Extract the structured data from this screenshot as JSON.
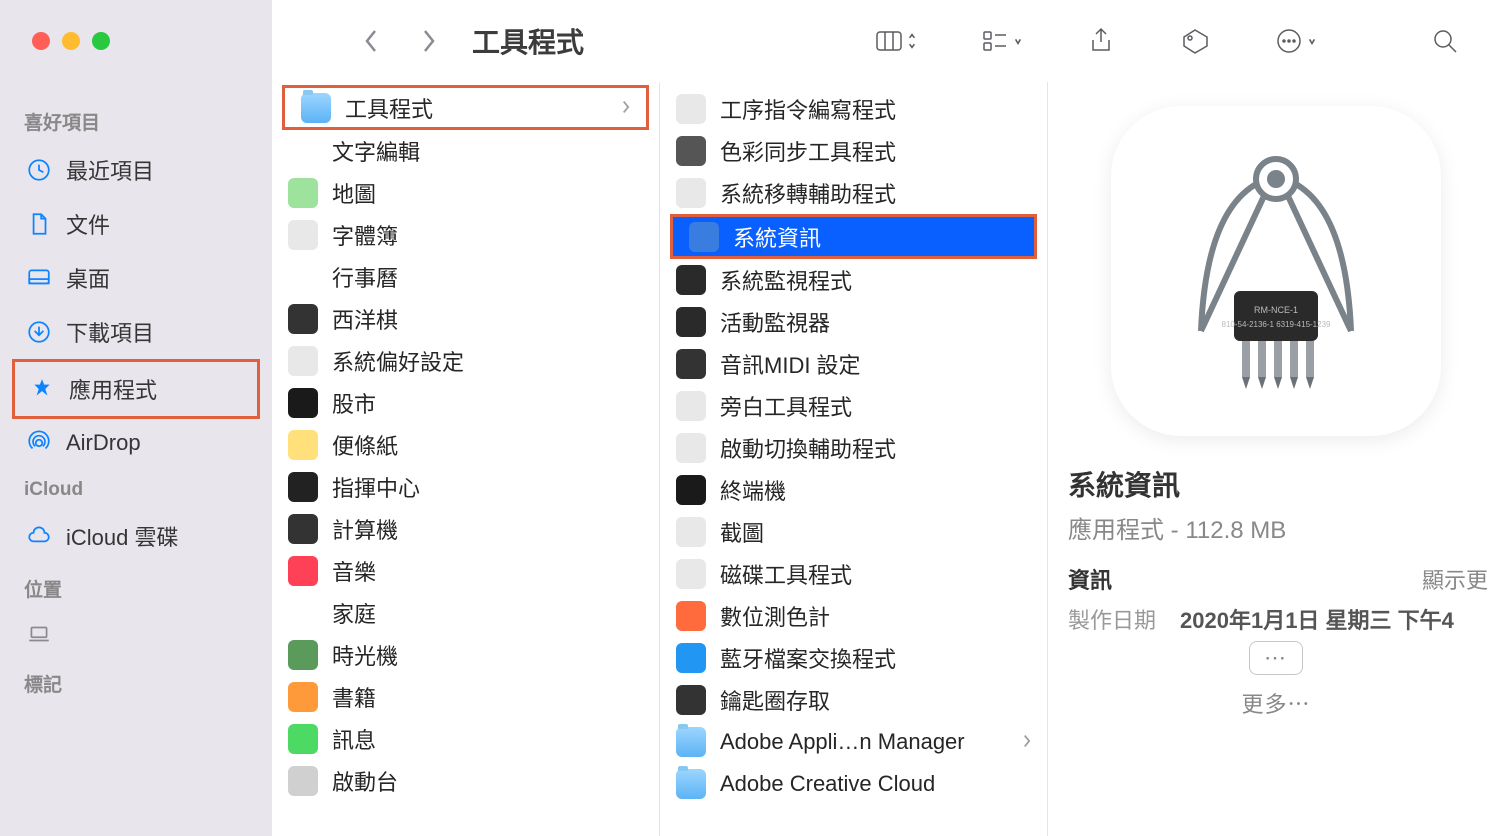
{
  "toolbar": {
    "title": "工具程式"
  },
  "sidebar": {
    "sections": [
      {
        "header": "喜好項目",
        "items": [
          {
            "label": "最近項目",
            "icon": "clock"
          },
          {
            "label": "文件",
            "icon": "doc"
          },
          {
            "label": "桌面",
            "icon": "desktop"
          },
          {
            "label": "下載項目",
            "icon": "download"
          },
          {
            "label": "應用程式",
            "icon": "apps",
            "hl": true
          },
          {
            "label": "AirDrop",
            "icon": "airdrop"
          }
        ]
      },
      {
        "header": "iCloud",
        "items": [
          {
            "label": "iCloud 雲碟",
            "icon": "cloud"
          }
        ]
      },
      {
        "header": "位置",
        "items": [
          {
            "label": "",
            "icon": "laptop",
            "loc": true
          }
        ]
      },
      {
        "header": "標記",
        "items": []
      }
    ]
  },
  "col1": [
    {
      "label": "工具程式",
      "icon": "folder",
      "hl": true,
      "chev": true
    },
    {
      "label": "文字編輯",
      "icon": "textedit"
    },
    {
      "label": "地圖",
      "icon": "maps"
    },
    {
      "label": "字體簿",
      "icon": "fontbook"
    },
    {
      "label": "行事曆",
      "icon": "calendar"
    },
    {
      "label": "西洋棋",
      "icon": "chess"
    },
    {
      "label": "系統偏好設定",
      "icon": "gear"
    },
    {
      "label": "股市",
      "icon": "stocks"
    },
    {
      "label": "便條紙",
      "icon": "stickies"
    },
    {
      "label": "指揮中心",
      "icon": "mission"
    },
    {
      "label": "計算機",
      "icon": "calc"
    },
    {
      "label": "音樂",
      "icon": "music"
    },
    {
      "label": "家庭",
      "icon": "home"
    },
    {
      "label": "時光機",
      "icon": "timemachine"
    },
    {
      "label": "書籍",
      "icon": "books"
    },
    {
      "label": "訊息",
      "icon": "messages"
    },
    {
      "label": "啟動台",
      "icon": "launchpad"
    }
  ],
  "col2": [
    {
      "label": "工序指令編寫程式",
      "icon": "script"
    },
    {
      "label": "色彩同步工具程式",
      "icon": "colorsync"
    },
    {
      "label": "系統移轉輔助程式",
      "icon": "migration"
    },
    {
      "label": "系統資訊",
      "icon": "sysinfo",
      "sel": true,
      "hl": true
    },
    {
      "label": "系統監視程式",
      "icon": "console"
    },
    {
      "label": "活動監視器",
      "icon": "activity"
    },
    {
      "label": "音訊MIDI 設定",
      "icon": "midi"
    },
    {
      "label": "旁白工具程式",
      "icon": "voiceover"
    },
    {
      "label": "啟動切換輔助程式",
      "icon": "bootcamp"
    },
    {
      "label": "終端機",
      "icon": "terminal"
    },
    {
      "label": "截圖",
      "icon": "screenshot"
    },
    {
      "label": "磁碟工具程式",
      "icon": "diskutil"
    },
    {
      "label": "數位測色計",
      "icon": "colormeter"
    },
    {
      "label": "藍牙檔案交換程式",
      "icon": "bluetooth"
    },
    {
      "label": "鑰匙圈存取",
      "icon": "keychain"
    },
    {
      "label": "Adobe Appli…n Manager",
      "icon": "folder",
      "chev": true
    },
    {
      "label": "Adobe Creative Cloud",
      "icon": "folder"
    }
  ],
  "preview": {
    "name": "系統資訊",
    "sub": "應用程式 - 112.8 MB",
    "info_label": "資訊",
    "info_link": "顯示更",
    "meta_label": "製作日期",
    "meta_value": "2020年1月1日 星期三 下午4",
    "more": "更多⋯"
  }
}
